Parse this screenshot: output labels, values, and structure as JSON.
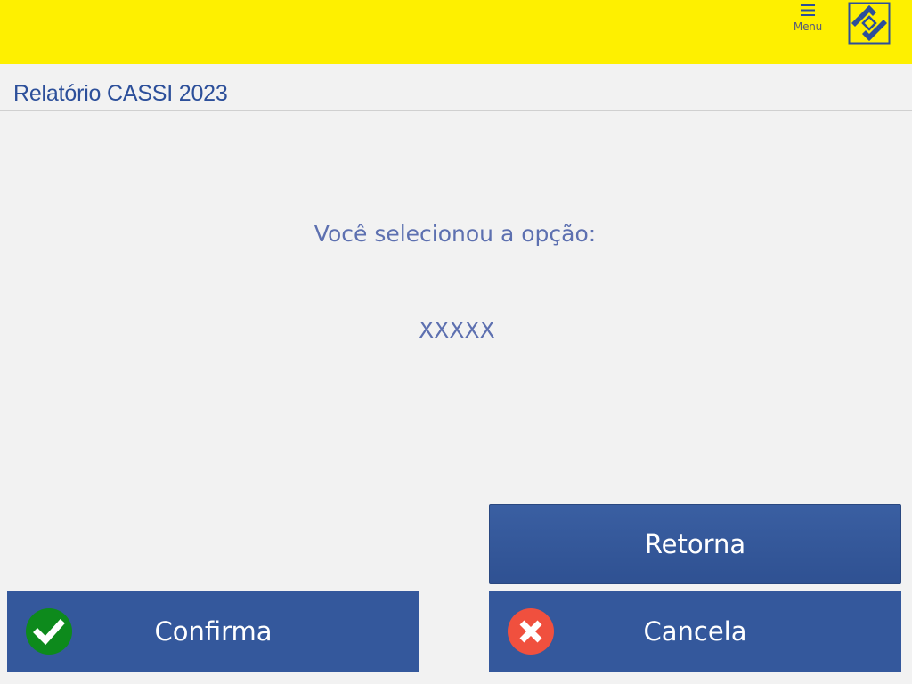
{
  "header": {
    "menu_label": "Menu",
    "menu_icon": "hamburger-icon",
    "logo_icon": "banco-do-brasil-logo",
    "background_color": "#fef000"
  },
  "page": {
    "title": "Relatório CASSI 2023"
  },
  "content": {
    "prompt": "Você selecionou a opção:",
    "selected_option": "XXXXX"
  },
  "buttons": {
    "retorna_label": "Retorna",
    "confirma_label": "Confirma",
    "confirma_icon": "check-icon",
    "cancela_label": "Cancela",
    "cancela_icon": "close-icon"
  },
  "colors": {
    "button": "#34589c",
    "text_accent": "#2c4f9a",
    "confirm_icon": "#0d8a1c",
    "cancel_icon": "#f0503e"
  }
}
